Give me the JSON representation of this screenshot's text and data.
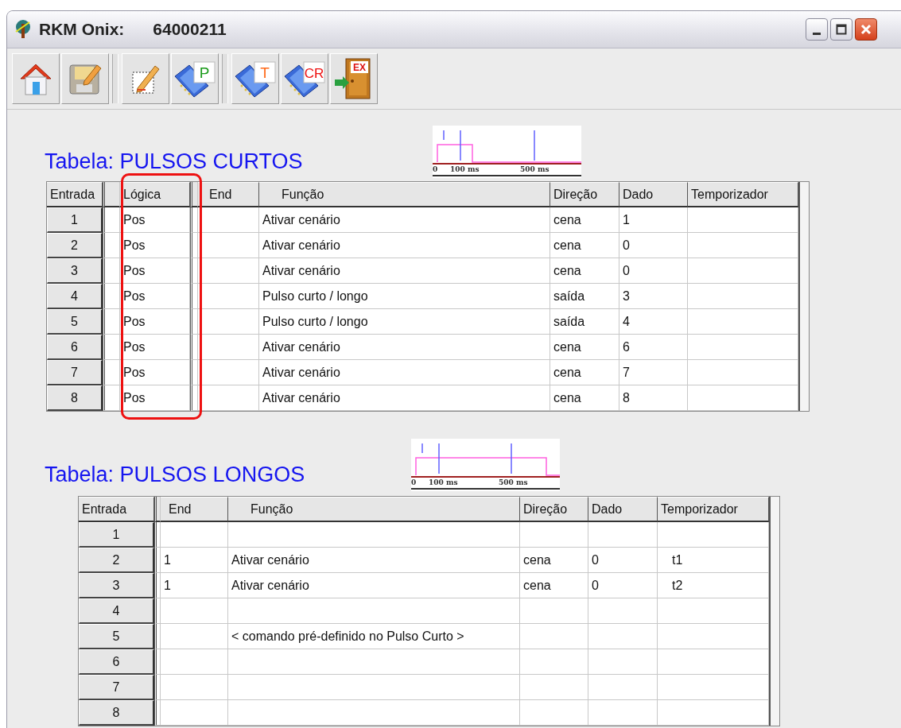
{
  "window": {
    "title": "RKM Onix:",
    "serial": "64000211",
    "controls": [
      {
        "kind": "minimize"
      },
      {
        "kind": "maximize"
      },
      {
        "kind": "close"
      }
    ]
  },
  "toolbar": [
    {
      "kind": "home"
    },
    {
      "kind": "save"
    },
    {
      "kind": "separator"
    },
    {
      "kind": "edit"
    },
    {
      "kind": "notebook",
      "label": "P",
      "color": "#1a9a1a"
    },
    {
      "kind": "separator"
    },
    {
      "kind": "notebook",
      "label": "T",
      "color": "#ff6a1a"
    },
    {
      "kind": "notebook",
      "label": "CR",
      "color": "#ee1111"
    },
    {
      "kind": "exit",
      "label": "EX",
      "color": "#dd1111"
    }
  ],
  "tables": [
    {
      "title": "Tabela: PULSOS CURTOS",
      "diagram": {
        "kind": "short",
        "ticks": [
          "0",
          "100 ms",
          "500 ms"
        ]
      },
      "columns": [
        {
          "label": "Entrada",
          "highlighted": false
        },
        {
          "label": "Lógica",
          "highlighted": true
        },
        {
          "label": "End",
          "highlighted": false
        },
        {
          "label": "Função",
          "highlighted": false
        },
        {
          "label": "Direção",
          "highlighted": false
        },
        {
          "label": "Dado",
          "highlighted": false
        },
        {
          "label": "Temporizador",
          "highlighted": false
        }
      ],
      "rows": [
        {
          "cells": [
            "1",
            "Pos",
            null,
            "Ativar cenário",
            "cena",
            "1",
            null
          ]
        },
        {
          "cells": [
            "2",
            "Pos",
            null,
            "Ativar cenário",
            "cena",
            "0",
            null
          ]
        },
        {
          "cells": [
            "3",
            "Pos",
            null,
            "Ativar cenário",
            "cena",
            "0",
            null
          ]
        },
        {
          "cells": [
            "4",
            "Pos",
            null,
            "Pulso curto / longo",
            "saída",
            "3",
            null
          ]
        },
        {
          "cells": [
            "5",
            "Pos",
            null,
            "Pulso curto / longo",
            "saída",
            "4",
            null
          ]
        },
        {
          "cells": [
            "6",
            "Pos",
            null,
            "Ativar cenário",
            "cena",
            "6",
            null
          ]
        },
        {
          "cells": [
            "7",
            "Pos",
            null,
            "Ativar cenário",
            "cena",
            "7",
            null
          ]
        },
        {
          "cells": [
            "8",
            "Pos",
            null,
            "Ativar cenário",
            "cena",
            "8",
            null
          ]
        }
      ]
    },
    {
      "title": "Tabela: PULSOS LONGOS",
      "diagram": {
        "kind": "long",
        "ticks": [
          "0",
          "100 ms",
          "500 ms"
        ]
      },
      "columns": [
        {
          "label": "Entrada",
          "highlighted": false
        },
        {
          "label": "End",
          "highlighted": false
        },
        {
          "label": "Função",
          "highlighted": false
        },
        {
          "label": "Direção",
          "highlighted": false
        },
        {
          "label": "Dado",
          "highlighted": false
        },
        {
          "label": "Temporizador",
          "highlighted": false
        }
      ],
      "rows": [
        {
          "cells": [
            "1",
            null,
            null,
            null,
            null,
            null
          ]
        },
        {
          "cells": [
            "2",
            "1",
            "Ativar cenário",
            "cena",
            "0",
            "t1"
          ]
        },
        {
          "cells": [
            "3",
            "1",
            "Ativar cenário",
            "cena",
            "0",
            "t2"
          ]
        },
        {
          "cells": [
            "4",
            null,
            null,
            null,
            null,
            null
          ]
        },
        {
          "cells": [
            "5",
            null,
            "< comando pré-definido no Pulso Curto >",
            null,
            null,
            null
          ]
        },
        {
          "cells": [
            "6",
            null,
            null,
            null,
            null,
            null
          ]
        },
        {
          "cells": [
            "7",
            null,
            null,
            null,
            null,
            null
          ]
        },
        {
          "cells": [
            "8",
            null,
            null,
            null,
            null,
            null
          ]
        }
      ]
    }
  ]
}
